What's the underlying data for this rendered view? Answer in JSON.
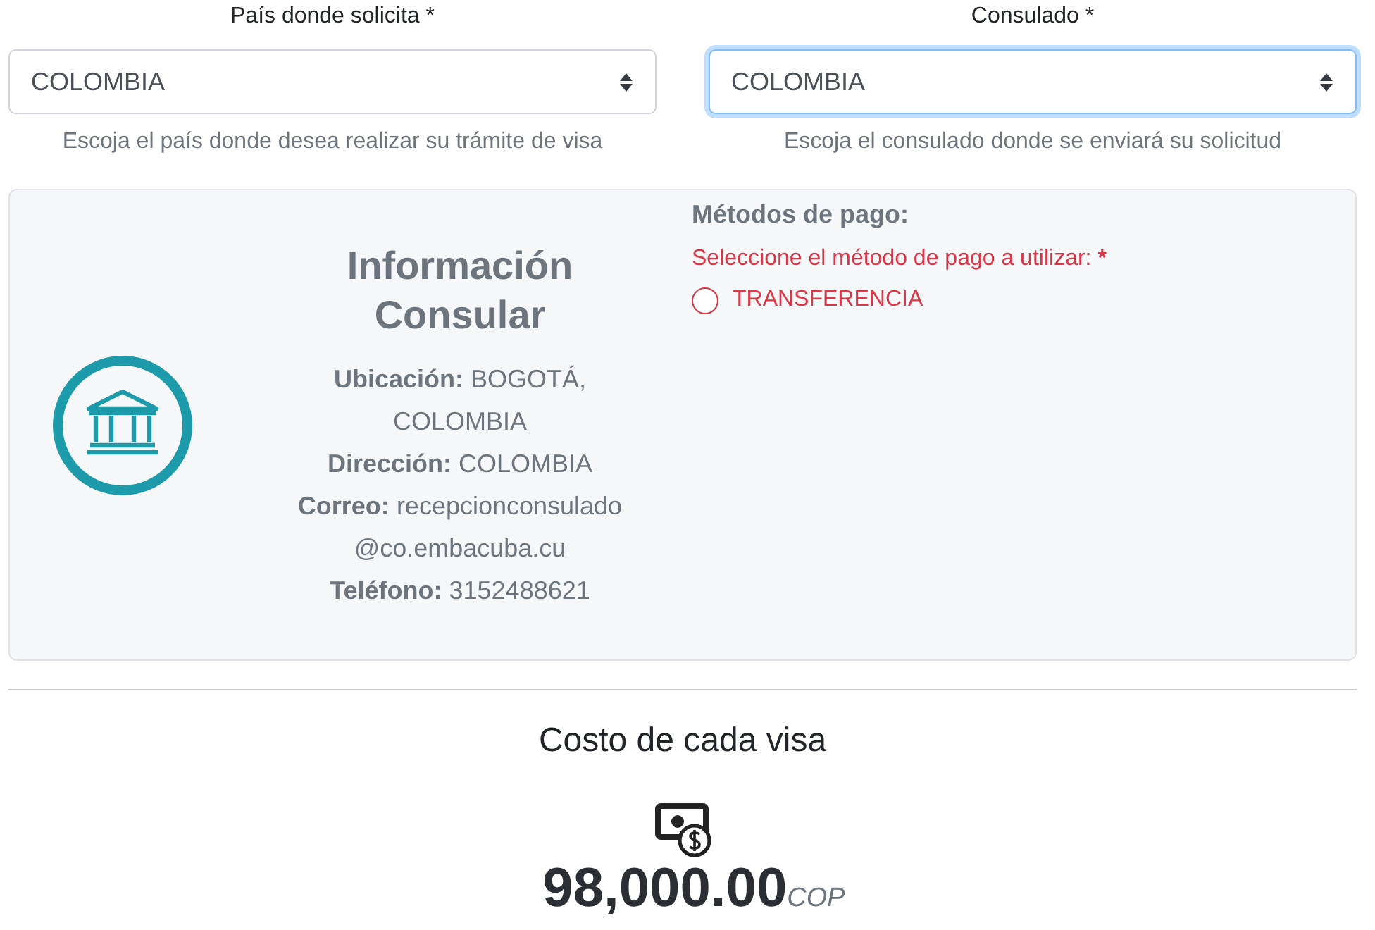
{
  "fields": [
    {
      "label": "País donde solicita *",
      "value": "COLOMBIA",
      "help": "Escoja el país donde desea realizar su trámite de visa",
      "focused": false
    },
    {
      "label": "Consulado *",
      "value": "COLOMBIA",
      "help": "Escoja el consulado donde se enviará su solicitud",
      "focused": true
    }
  ],
  "consular_info": {
    "title": "Información Consular",
    "lines": [
      "**Ubicación:** BOGOTÁ, COLOMBIA",
      "**Dirección:** COLOMBIA",
      "**Correo:** recepcionconsulado@co.embacuba.cu",
      "**Teléfono:** 3152488621"
    ]
  },
  "payment": {
    "title": "Métodos de pago:",
    "prompt": "Seleccione el método de pago a utilizar:",
    "required_mark": "*",
    "invalid": true,
    "methods": [
      {
        "label": "TRANSFERENCIA",
        "selected": false
      }
    ]
  },
  "cost": {
    "title": "Costo de cada visa",
    "amount": "98,000.00",
    "currency": "COP"
  }
}
